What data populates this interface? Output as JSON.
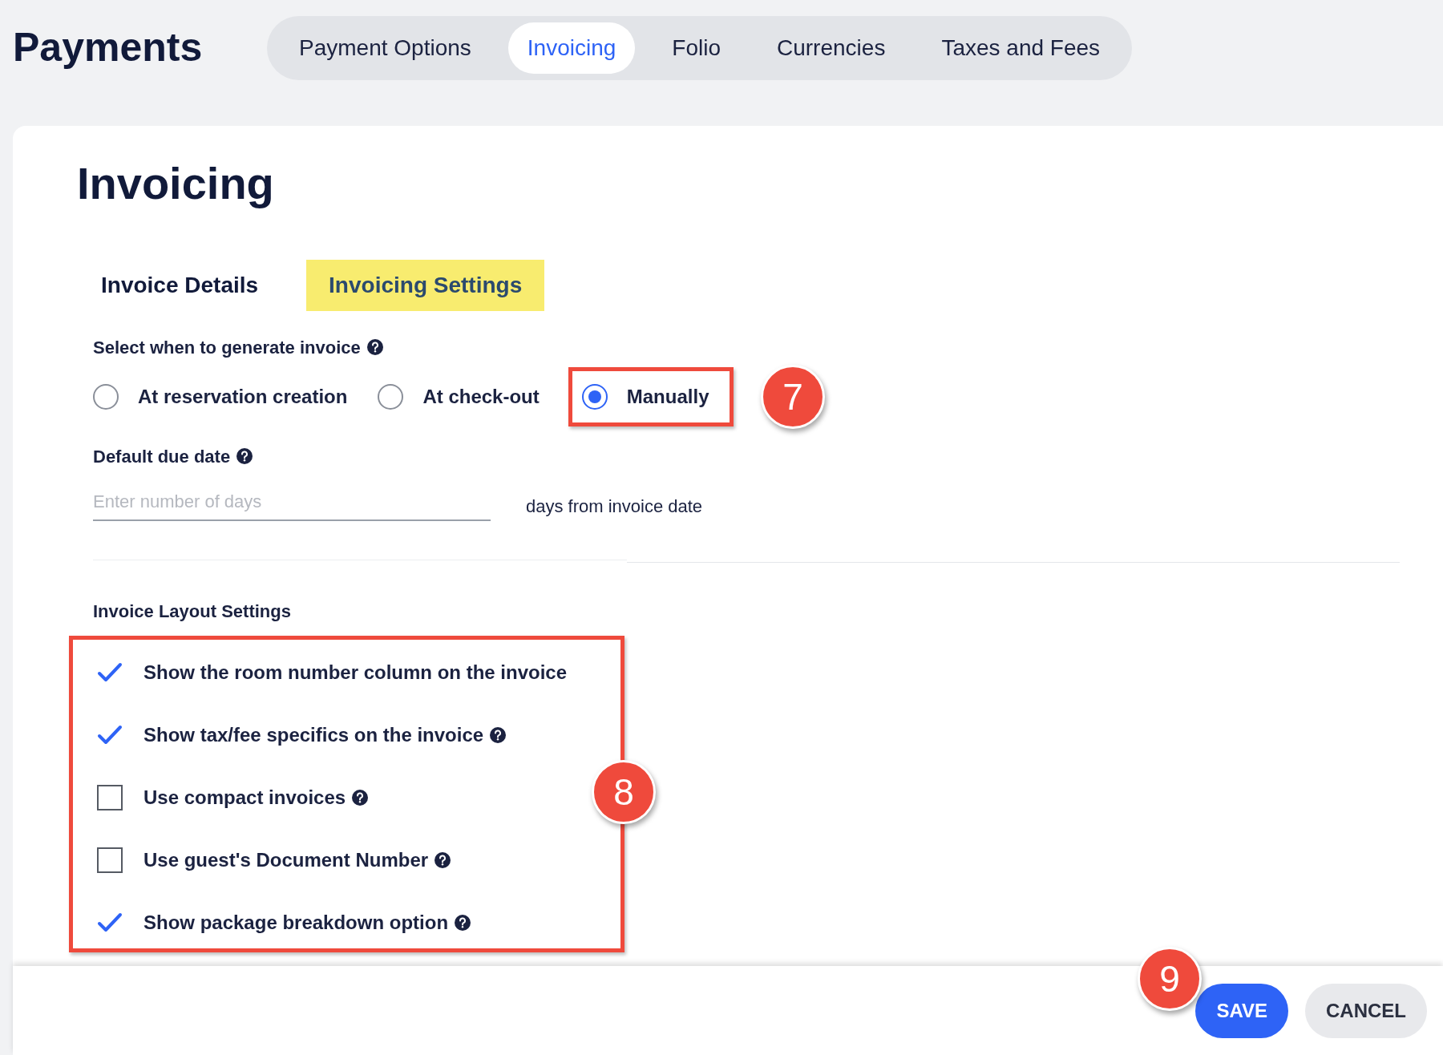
{
  "header": {
    "title": "Payments",
    "tabs": [
      {
        "label": "Payment Options",
        "selected": false
      },
      {
        "label": "Invoicing",
        "selected": true
      },
      {
        "label": "Folio",
        "selected": false
      },
      {
        "label": "Currencies",
        "selected": false
      },
      {
        "label": "Taxes and Fees",
        "selected": false
      }
    ]
  },
  "page": {
    "title": "Invoicing",
    "subtabs": [
      {
        "label": "Invoice Details",
        "selected": false
      },
      {
        "label": "Invoicing Settings",
        "selected": true
      }
    ]
  },
  "generate_invoice": {
    "label": "Select when to generate invoice",
    "options": [
      {
        "label": "At reservation creation",
        "selected": false,
        "highlighted": false
      },
      {
        "label": "At check-out",
        "selected": false,
        "highlighted": false
      },
      {
        "label": "Manually",
        "selected": true,
        "highlighted": true
      }
    ]
  },
  "due_date": {
    "label": "Default due date",
    "placeholder": "Enter number of days",
    "suffix": "days from invoice date"
  },
  "layout_settings": {
    "label": "Invoice Layout Settings",
    "highlighted": true,
    "items": [
      {
        "label": "Show the room number column on the invoice",
        "checked": true,
        "help": false
      },
      {
        "label": "Show tax/fee specifics on the invoice",
        "checked": true,
        "help": true
      },
      {
        "label": "Use compact invoices",
        "checked": false,
        "help": true
      },
      {
        "label": "Use guest's Document Number",
        "checked": false,
        "help": true
      },
      {
        "label": "Show package breakdown option",
        "checked": true,
        "help": true
      }
    ]
  },
  "buttons": [
    {
      "label": "SAVE",
      "kind": "primary"
    },
    {
      "label": "CANCEL",
      "kind": "secondary"
    }
  ],
  "annotations": [
    {
      "number": "7"
    },
    {
      "number": "8"
    },
    {
      "number": "9"
    }
  ]
}
